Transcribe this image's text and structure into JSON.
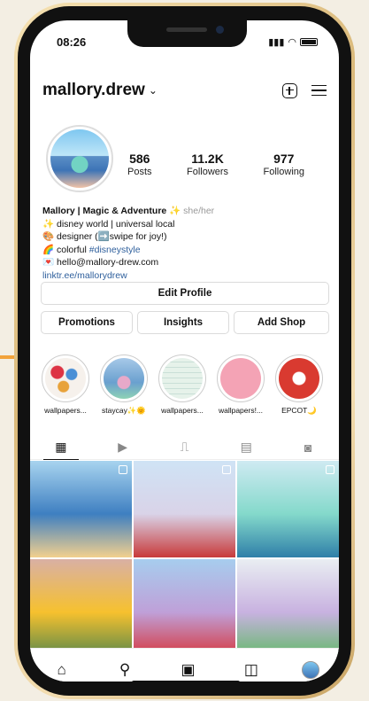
{
  "status_bar": {
    "time": "08:26"
  },
  "header": {
    "username": "mallory.drew"
  },
  "stats": [
    {
      "value": "586",
      "label": "Posts"
    },
    {
      "value": "11.2K",
      "label": "Followers"
    },
    {
      "value": "977",
      "label": "Following"
    }
  ],
  "bio": {
    "name": "Mallory | Magic & Adventure ✨",
    "pronouns": "she/her",
    "line1": "✨ disney world | universal local",
    "line2": "🎨 designer (➡️swipe for joy!)",
    "line3_prefix": "🌈 colorful ",
    "line3_tag": "#disneystyle",
    "line4": "💌 hello@mallory-drew.com",
    "link": "linktr.ee/mallorydrew"
  },
  "buttons": {
    "edit_profile": "Edit Profile",
    "promotions": "Promotions",
    "insights": "Insights",
    "add_shop": "Add Shop"
  },
  "highlights": [
    {
      "label": "wallpapers...",
      "color": "#f6f1ec"
    },
    {
      "label": "staycay✨🌞",
      "color": "#a7c9e8"
    },
    {
      "label": "wallpapers...",
      "color": "#e6f2ea"
    },
    {
      "label": "wallpapers!...",
      "color": "#f4a3b5"
    },
    {
      "label": "EPCOT🌙",
      "color": "#d93a30"
    }
  ],
  "tabs": [
    "grid-icon",
    "reels-icon",
    "igtv-icon",
    "guides-icon",
    "tagged-icon"
  ],
  "posts": [
    {
      "colors": [
        "#a8d4ef",
        "#3e7fc1",
        "#f2d08e"
      ]
    },
    {
      "colors": [
        "#cfe3f5",
        "#d9d3e8",
        "#c83a3a"
      ]
    },
    {
      "colors": [
        "#cfeaf2",
        "#84d9cb",
        "#2f7fa8"
      ]
    },
    {
      "colors": [
        "#d9b0a4",
        "#f6c12e",
        "#5f8a4a"
      ]
    },
    {
      "colors": [
        "#a7cdee",
        "#bfa0d8",
        "#d53b44"
      ]
    },
    {
      "colors": [
        "#e9eef2",
        "#c8b2e0",
        "#67b96f"
      ]
    }
  ],
  "bottom_nav": [
    "home-icon",
    "search-icon",
    "reels-icon",
    "shop-icon",
    "profile-avatar"
  ]
}
